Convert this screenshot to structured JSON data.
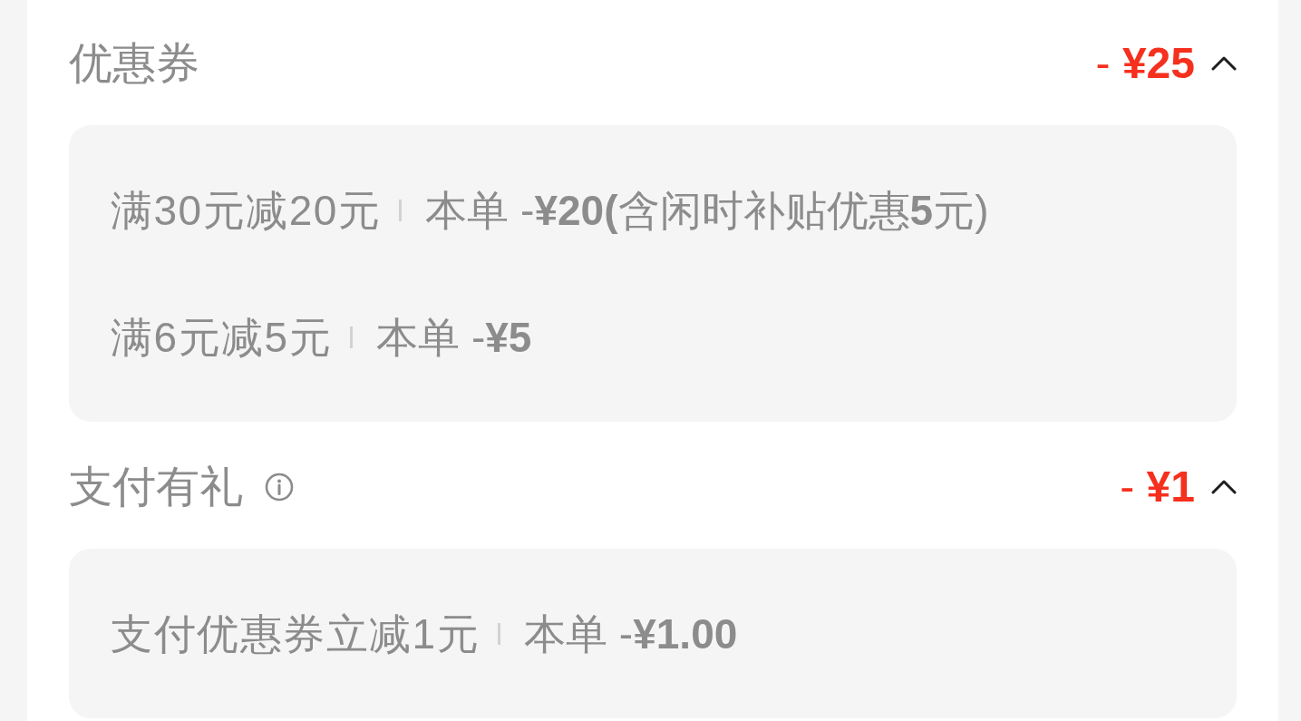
{
  "sections": [
    {
      "title": "优惠券",
      "info_icon": false,
      "amount": "- **¥25**",
      "expanded": true,
      "items": [
        {
          "condition": "满30元减20元",
          "detail": "本单 -**¥20(**含闲时补贴优惠**5**元)"
        },
        {
          "condition": "满6元减5元",
          "detail": "本单 -**¥5**"
        }
      ]
    },
    {
      "title": "支付有礼",
      "info_icon": true,
      "amount": "- **¥1**",
      "expanded": true,
      "items": [
        {
          "condition": "支付优惠券立减1元",
          "detail": "本单 -**¥1.00**"
        }
      ]
    }
  ]
}
